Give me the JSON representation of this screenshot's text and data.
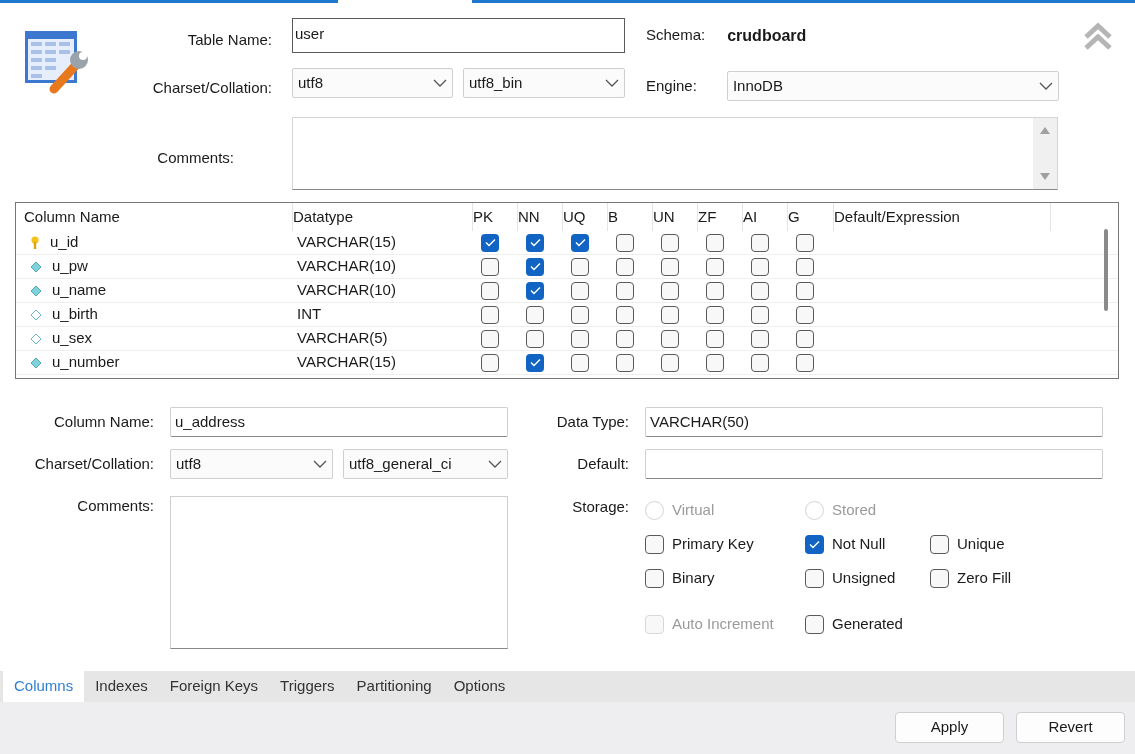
{
  "table": {
    "name_label": "Table Name:",
    "name": "user",
    "schema_label": "Schema:",
    "schema": "crudboard",
    "charset_label": "Charset/Collation:",
    "charset": "utf8",
    "collation": "utf8_bin",
    "engine_label": "Engine:",
    "engine": "InnoDB",
    "comments_label": "Comments:"
  },
  "columns_grid": {
    "headers": [
      "Column Name",
      "Datatype",
      "PK",
      "NN",
      "UQ",
      "B",
      "UN",
      "ZF",
      "AI",
      "G",
      "Default/Expression"
    ],
    "rows": [
      {
        "name": "u_id",
        "datatype": "VARCHAR(15)",
        "flags": [
          true,
          true,
          true,
          false,
          false,
          false,
          false,
          false
        ]
      },
      {
        "name": "u_pw",
        "datatype": "VARCHAR(10)",
        "flags": [
          false,
          true,
          false,
          false,
          false,
          false,
          false,
          false
        ]
      },
      {
        "name": "u_name",
        "datatype": "VARCHAR(10)",
        "flags": [
          false,
          true,
          false,
          false,
          false,
          false,
          false,
          false
        ]
      },
      {
        "name": "u_birth",
        "datatype": "INT",
        "flags": [
          false,
          false,
          false,
          false,
          false,
          false,
          false,
          false
        ]
      },
      {
        "name": "u_sex",
        "datatype": "VARCHAR(5)",
        "flags": [
          false,
          false,
          false,
          false,
          false,
          false,
          false,
          false
        ]
      },
      {
        "name": "u_number",
        "datatype": "VARCHAR(15)",
        "flags": [
          false,
          true,
          false,
          false,
          false,
          false,
          false,
          false
        ]
      }
    ]
  },
  "column_detail": {
    "name_label": "Column Name:",
    "name": "u_address",
    "datatype_label": "Data Type:",
    "datatype": "VARCHAR(50)",
    "charset_label": "Charset/Collation:",
    "charset": "utf8",
    "collation": "utf8_general_ci",
    "default_label": "Default:",
    "comments_label": "Comments:",
    "storage_label": "Storage:",
    "options": [
      [
        {
          "kind": "radio",
          "label": "Virtual",
          "checked": false,
          "disabled": true
        },
        {
          "kind": "radio",
          "label": "Stored",
          "checked": false,
          "disabled": true
        }
      ],
      [
        {
          "kind": "checkbox",
          "label": "Primary Key",
          "checked": false,
          "disabled": false
        },
        {
          "kind": "checkbox",
          "label": "Not Null",
          "checked": true,
          "disabled": false
        },
        {
          "kind": "checkbox",
          "label": "Unique",
          "checked": false,
          "disabled": false
        }
      ],
      [
        {
          "kind": "checkbox",
          "label": "Binary",
          "checked": false,
          "disabled": false
        },
        {
          "kind": "checkbox",
          "label": "Unsigned",
          "checked": false,
          "disabled": false
        },
        {
          "kind": "checkbox",
          "label": "Zero Fill",
          "checked": false,
          "disabled": false
        }
      ],
      [
        {
          "kind": "checkbox",
          "label": "Auto Increment",
          "checked": false,
          "disabled": true
        },
        {
          "kind": "checkbox",
          "label": "Generated",
          "checked": false,
          "disabled": false
        }
      ]
    ]
  },
  "tabs": [
    {
      "label": "Columns",
      "selected": true
    },
    {
      "label": "Indexes",
      "selected": false
    },
    {
      "label": "Foreign Keys",
      "selected": false
    },
    {
      "label": "Triggers",
      "selected": false
    },
    {
      "label": "Partitioning",
      "selected": false
    },
    {
      "label": "Options",
      "selected": false
    }
  ],
  "buttons": [
    "Apply",
    "Revert"
  ]
}
